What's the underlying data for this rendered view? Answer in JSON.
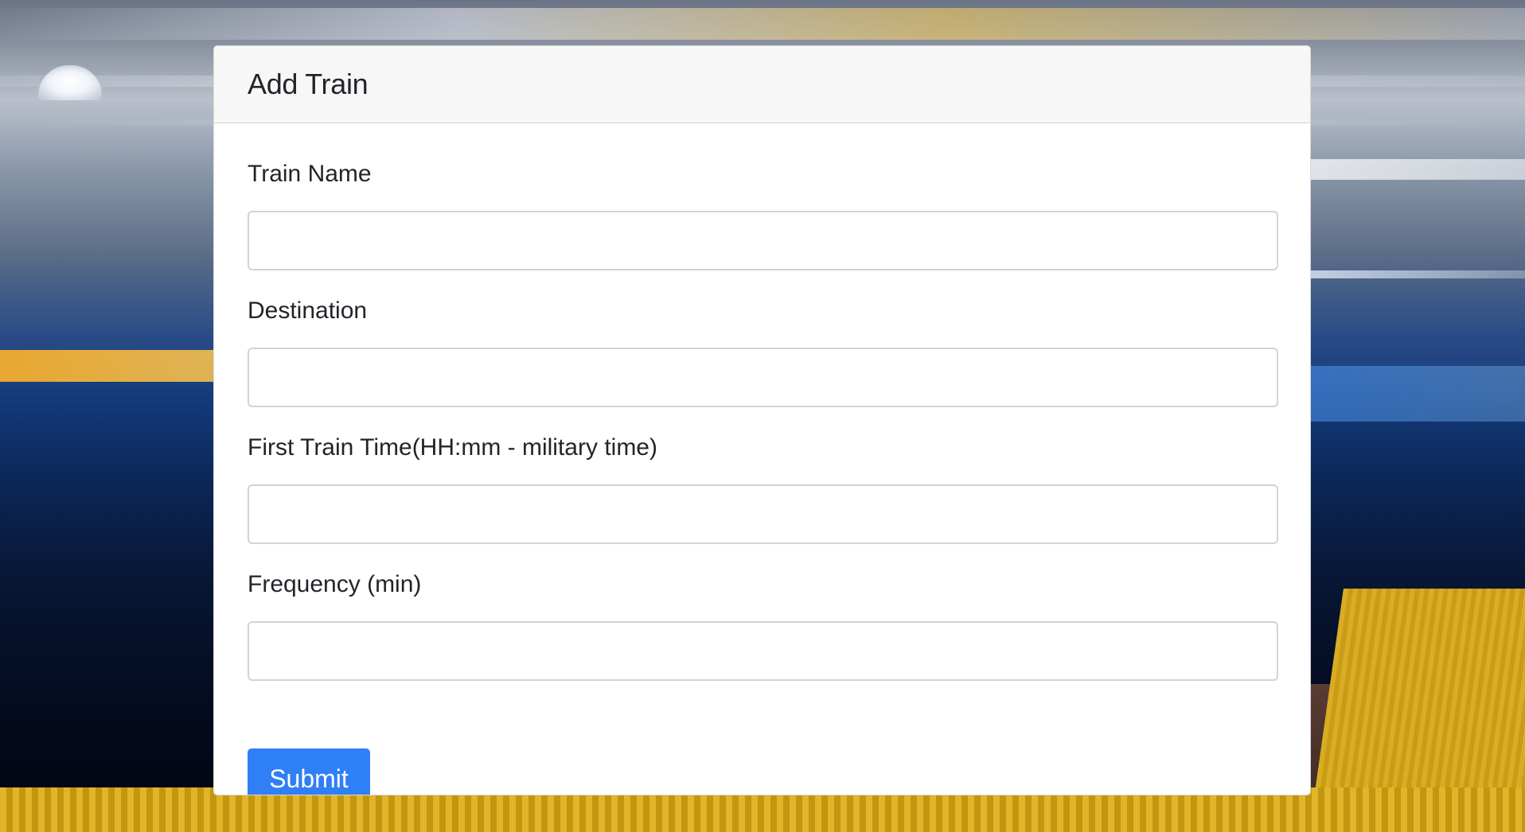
{
  "form": {
    "title": "Add Train",
    "fields": [
      {
        "label": "Train Name",
        "value": "",
        "placeholder": ""
      },
      {
        "label": "Destination",
        "value": "",
        "placeholder": ""
      },
      {
        "label": "First Train Time(HH:mm - military time)",
        "value": "",
        "placeholder": ""
      },
      {
        "label": "Frequency (min)",
        "value": "",
        "placeholder": ""
      }
    ],
    "submit_label": "Submit"
  },
  "colors": {
    "accent": "#2f7ff7",
    "card_header_bg": "#f7f7f7",
    "input_border": "#ced4da"
  }
}
